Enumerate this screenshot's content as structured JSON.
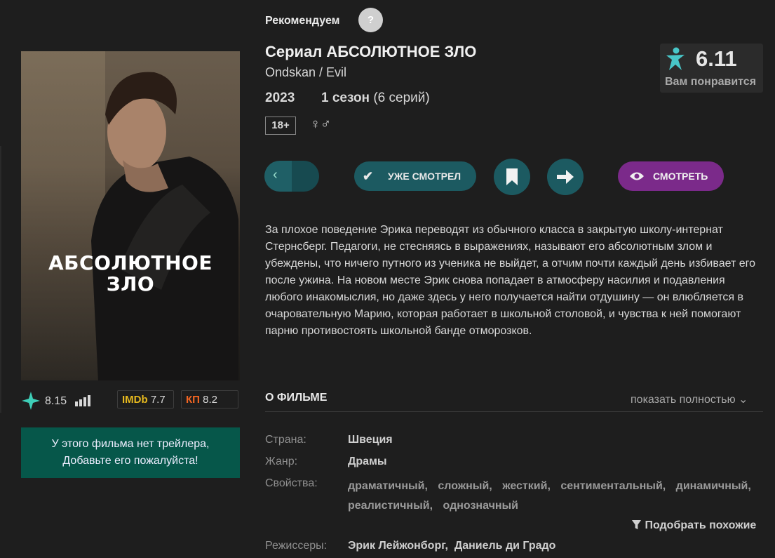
{
  "recommend": {
    "label": "Рекомендуем",
    "help": "?"
  },
  "movie": {
    "title": "Сериал АБСОЛЮТНОЕ ЗЛО",
    "original_title": "Ondskan / Evil",
    "year": "2023",
    "seasons_bold": "1 сезон",
    "seasons_rest": " (6 серий)",
    "age": "18+",
    "gender_icon": "♀♂",
    "poster_title_line1": "АБСОЛЮТНОЕ",
    "poster_title_line2": "ЗЛО"
  },
  "score": {
    "value": "6.11",
    "label": "Вам понравится",
    "color": "#48c6c8"
  },
  "ratings": {
    "site": "8.15",
    "imdb_label": "IMDb",
    "imdb": "7.7",
    "kp_label": "КП",
    "kp": "8.2"
  },
  "trailer": {
    "line1": "У этого фильма нет трейлера,",
    "line2": "Добавьте его пожалуйста!"
  },
  "buttons": {
    "back": "‹",
    "watched": "УЖЕ СМОТРЕЛ",
    "watch": "СМОТРЕТЬ"
  },
  "description": "За плохое поведение Эрика переводят из обычного класса в закрытую школу-интернат Стернсберг. Педагоги, не стесняясь в выражениях, называют его абсолютным злом и убеждены, что ничего путного из ученика не выйдет, а отчим почти каждый день избивает его после ужина. На новом месте Эрик снова попадает в атмосферу насилия и подавления любого инакомыслия, но даже здесь у него получается найти отдушину — он влюбляется в очаровательную Марию, которая работает в школьной столовой, и чувства к ней помогают парню противостоять школьной банде отморозков.",
  "about": {
    "heading": "О ФИЛЬМЕ",
    "show_full": "показать полностью ⌄",
    "country_label": "Страна:",
    "country": "Швеция",
    "genre_label": "Жанр:",
    "genre": "Драмы",
    "props_label": "Свойства:",
    "props": [
      "драматичный,",
      "сложный,",
      "жесткий,",
      "сентиментальный,",
      "динамичный,",
      "реалистичный,",
      "однозначный"
    ],
    "similar": "Подобрать похожие",
    "directors_label": "Режиссеры:",
    "directors": "Эрик Лейжонборг,  Даниель ди Градо"
  },
  "colors": {
    "teal": "#1c5a61",
    "purple": "#7b2a8a",
    "trailer_bg": "#06574a",
    "imdb": "#e6b91e",
    "kp": "#f26522"
  }
}
